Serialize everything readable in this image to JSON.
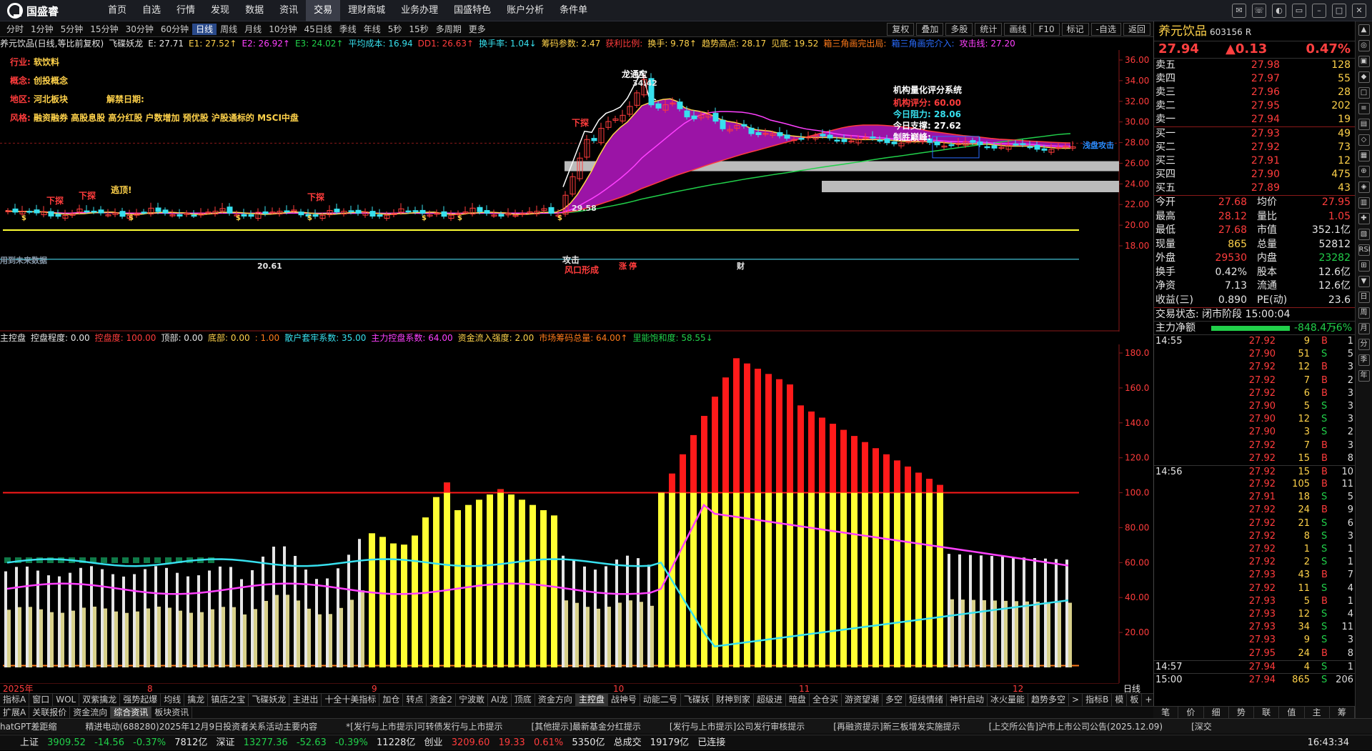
{
  "app": {
    "brand": "国盛睿"
  },
  "menu": [
    "首页",
    "自选",
    "行情",
    "发现",
    "数据",
    "资讯",
    "交易",
    "理财商城",
    "业务办理",
    "国盛特色",
    "账户分析",
    "条件单"
  ],
  "menu_active": "交易",
  "periods": [
    "分时",
    "1分钟",
    "5分钟",
    "15分钟",
    "30分钟",
    "60分钟",
    "日线",
    "周线",
    "月线",
    "10分钟",
    "45日线",
    "季线",
    "年线",
    "5秒",
    "15秒",
    "多周期",
    "更多"
  ],
  "period_active": "日线",
  "tools": [
    "复权",
    "叠加",
    "多股",
    "统计",
    "画线",
    "F10",
    "标记",
    "-自选",
    "返回"
  ],
  "main_indicators": [
    {
      "t": "养元饮品(日线,等比前复权)",
      "c": "#e6e6e6"
    },
    {
      "t": "飞碟妖龙",
      "c": "#e6e6e6"
    },
    {
      "t": "E: 27.71",
      "c": "#e6e6e6"
    },
    {
      "t": "E1: 27.52↑",
      "c": "#ffd24a"
    },
    {
      "t": "E2: 26.92↑",
      "c": "#ff40ff"
    },
    {
      "t": "E3: 24.02↑",
      "c": "#21d04a"
    },
    {
      "t": "平均成本: 16.94",
      "c": "#37e0ee"
    },
    {
      "t": "DD1: 26.63↑",
      "c": "#ff3c3c"
    },
    {
      "t": "换手率: 1.04↓",
      "c": "#37e0ee"
    },
    {
      "t": "筹码参数: 2.47",
      "c": "#ffd24a"
    },
    {
      "t": "获利比例:",
      "c": "#ff3c3c"
    },
    {
      "t": "换手: 9.78↑",
      "c": "#ffd24a"
    },
    {
      "t": "趋势高点: 28.17",
      "c": "#ffd24a"
    },
    {
      "t": "见底: 19.52",
      "c": "#ffd24a"
    },
    {
      "t": "箱三角画完出局:",
      "c": "#ff7a1a"
    },
    {
      "t": "箱三角画完介入:",
      "c": "#2a6cff"
    },
    {
      "t": "攻击线: 27.20",
      "c": "#ff40ff"
    }
  ],
  "info": {
    "industry": {
      "k": "行业:",
      "v": "软饮料"
    },
    "concept": {
      "k": "概念:",
      "v": "创投概念"
    },
    "region": {
      "k": "地区:",
      "v": "河北板块"
    },
    "unlock": {
      "k": "解禁日期:",
      "v": ""
    },
    "style": {
      "k": "风格:",
      "v": "融资融券 高股息股 高分红股 户数增加 预优股 沪股通标的 MSCI中盘"
    }
  },
  "rating": {
    "title": "机构量化评分系统",
    "score": "机构评分:  60.00",
    "resist": "今日阻力:  28.06",
    "support": "今日支撑:  27.62",
    "peak": "制胜巅峰:"
  },
  "chart_labels": {
    "dragon": "龙通宝",
    "top_val": "34.42",
    "price_2958": "29.58",
    "low_val": "20.61",
    "wind": "风口形成",
    "attack": "攻击",
    "dig": "逃顶!",
    "xibo": "下探",
    "future": "用到未来数据",
    "zhang": "涨",
    "ting": "停",
    "cai": "财",
    "s_mark": "$",
    "shallow": "浅盘攻击"
  },
  "main_yaxis": [
    "36.00",
    "34.00",
    "32.00",
    "30.00",
    "28.00",
    "26.00",
    "24.00",
    "22.00",
    "20.00",
    "18.00"
  ],
  "sub_indicators": [
    {
      "t": "主控盘",
      "c": "#e6e6e6"
    },
    {
      "t": "控盘程度: 0.00",
      "c": "#e6e6e6"
    },
    {
      "t": "控盘度: 100.00",
      "c": "#ff3c3c"
    },
    {
      "t": "顶部: 0.00",
      "c": "#e6e6e6"
    },
    {
      "t": "底部: 0.00",
      "c": "#ffd24a"
    },
    {
      "t": ": 1.00",
      "c": "#ff7a1a"
    },
    {
      "t": "散户套牢系数: 35.00",
      "c": "#37e0ee"
    },
    {
      "t": "主力控盘系数: 64.00",
      "c": "#ff40ff"
    },
    {
      "t": "资金流入强度: 2.00",
      "c": "#ffd24a"
    },
    {
      "t": "市场筹码总量: 64.00↑",
      "c": "#ff7a1a"
    },
    {
      "t": "里能饱和度: 58.55↓",
      "c": "#21d04a"
    }
  ],
  "sub_yaxis": [
    "180.0",
    "160.0",
    "140.0",
    "120.0",
    "100.0",
    "80.00",
    "60.00",
    "40.00",
    "20.00"
  ],
  "xaxis": {
    "labels": [
      "2025年",
      "8",
      "9",
      "10",
      "11",
      "12"
    ],
    "right": "日线"
  },
  "bottom_tabs": [
    "指标A",
    "窗口",
    "WOL",
    "双紫擒龙",
    "强势起爆",
    "均线",
    "擒龙",
    "镇店之宝",
    "飞碟妖龙",
    "主进出",
    "十全十美指标",
    "加仓",
    "转点",
    "资金2",
    "宁波敢",
    "AI龙",
    "顶底",
    "资金方向",
    "主控盘",
    "战神号",
    "动能二号",
    "飞碟妖",
    "财神到家",
    "超级进",
    "暗盘",
    "全仓买",
    "游资望潮",
    "多空",
    "短线情绪",
    "神针启动",
    "冰火量能",
    "趋势多空",
    ">",
    "指标B",
    "模",
    "板",
    "+",
    "-"
  ],
  "bottom_active": "主控盘",
  "bottom_tabs2": [
    "扩展A",
    "关联报价",
    "资金流向",
    "综合资讯",
    "板块资讯"
  ],
  "bottom_tabs2_active": "综合资讯",
  "ticker": [
    "hatGPT差距缩",
    "精进电动(688280)2025年12月9日投资者关系活动主要内容",
    "*[发行与上市提示]可转债发行与上市提示",
    "[其他提示]最新基金分红提示",
    "[发行与上市提示]公司发行审核提示",
    "[再融资提示]新三板增发实施提示",
    "[上交所公告]沪市上市公司公告(2025.12.09)",
    "[深交"
  ],
  "status": {
    "sh": {
      "name": "上证",
      "price": "3909.52",
      "chg": "-14.56",
      "pct": "-0.37%",
      "amt": "7812亿"
    },
    "sz": {
      "name": "深证",
      "price": "13277.36",
      "chg": "-52.63",
      "pct": "-0.39%",
      "amt": "11228亿"
    },
    "cy": {
      "name": "创业",
      "price": "3209.60",
      "chg": "19.33",
      "pct": "0.61%",
      "amt": "5350亿"
    },
    "total_label": "总成交",
    "total": "19179亿",
    "conn": "已连接",
    "time": "16:43:34"
  },
  "stock": {
    "name": "养元饮品",
    "code": "603156",
    "flag": "R",
    "price": "27.94",
    "chg": "▲0.13",
    "pct": "0.47%"
  },
  "orderbook": {
    "sell": [
      {
        "l": "卖五",
        "p": "27.98",
        "v": "128"
      },
      {
        "l": "卖四",
        "p": "27.97",
        "v": "55"
      },
      {
        "l": "卖三",
        "p": "27.96",
        "v": "28"
      },
      {
        "l": "卖二",
        "p": "27.95",
        "v": "202"
      },
      {
        "l": "卖一",
        "p": "27.94",
        "v": "19"
      }
    ],
    "buy": [
      {
        "l": "买一",
        "p": "27.93",
        "v": "49"
      },
      {
        "l": "买二",
        "p": "27.92",
        "v": "73"
      },
      {
        "l": "买三",
        "p": "27.91",
        "v": "12"
      },
      {
        "l": "买四",
        "p": "27.90",
        "v": "475"
      },
      {
        "l": "买五",
        "p": "27.89",
        "v": "43"
      }
    ]
  },
  "quote": [
    {
      "a": "今开",
      "b": "27.68",
      "bc": "#ff3c3c",
      "c": "均价",
      "d": "27.95",
      "dc": "#ff3c3c"
    },
    {
      "a": "最高",
      "b": "28.12",
      "bc": "#ff3c3c",
      "c": "量比",
      "d": "1.05",
      "dc": "#ff3c3c"
    },
    {
      "a": "最低",
      "b": "27.68",
      "bc": "#ff3c3c",
      "c": "市值",
      "d": "352.1亿",
      "dc": "#e6e6e6"
    },
    {
      "a": "现量",
      "b": "865",
      "bc": "#ffd24a",
      "c": "总量",
      "d": "52812",
      "dc": "#e6e6e6"
    },
    {
      "a": "外盘",
      "b": "29530",
      "bc": "#ff3c3c",
      "c": "内盘",
      "d": "23282",
      "dc": "#21d04a"
    },
    {
      "a": "换手",
      "b": "0.42%",
      "bc": "#e6e6e6",
      "c": "股本",
      "d": "12.6亿",
      "dc": "#e6e6e6"
    },
    {
      "a": "净资",
      "b": "7.13",
      "bc": "#e6e6e6",
      "c": "流通",
      "d": "12.6亿",
      "dc": "#e6e6e6"
    },
    {
      "a": "收益(三)",
      "b": "0.890",
      "bc": "#e6e6e6",
      "c": "PE(动)",
      "d": "23.6",
      "dc": "#e6e6e6"
    }
  ],
  "trade_state": "交易状态: 闭市阶段 15:00:04",
  "netflow": {
    "label": "主力净额",
    "value": "-848.4万",
    "pct": "-6%"
  },
  "ticks": [
    {
      "t": "14:55",
      "p": "27.92",
      "v": "9",
      "f": "B",
      "n": "1"
    },
    {
      "t": "",
      "p": "27.90",
      "v": "51",
      "f": "S",
      "n": "5"
    },
    {
      "t": "",
      "p": "27.92",
      "v": "12",
      "f": "B",
      "n": "3"
    },
    {
      "t": "",
      "p": "27.92",
      "v": "7",
      "f": "B",
      "n": "2"
    },
    {
      "t": "",
      "p": "27.92",
      "v": "6",
      "f": "B",
      "n": "3"
    },
    {
      "t": "",
      "p": "27.90",
      "v": "5",
      "f": "S",
      "n": "3"
    },
    {
      "t": "",
      "p": "27.90",
      "v": "12",
      "f": "S",
      "n": "3"
    },
    {
      "t": "",
      "p": "27.90",
      "v": "3",
      "f": "S",
      "n": "2"
    },
    {
      "t": "",
      "p": "27.92",
      "v": "7",
      "f": "B",
      "n": "3"
    },
    {
      "t": "",
      "p": "27.92",
      "v": "15",
      "f": "B",
      "n": "8"
    },
    {
      "t": "14:56",
      "p": "27.92",
      "v": "15",
      "f": "B",
      "n": "10"
    },
    {
      "t": "",
      "p": "27.92",
      "v": "105",
      "f": "B",
      "n": "11"
    },
    {
      "t": "",
      "p": "27.91",
      "v": "18",
      "f": "S",
      "n": "5"
    },
    {
      "t": "",
      "p": "27.92",
      "v": "24",
      "f": "B",
      "n": "9"
    },
    {
      "t": "",
      "p": "27.92",
      "v": "21",
      "f": "S",
      "n": "6"
    },
    {
      "t": "",
      "p": "27.92",
      "v": "8",
      "f": "S",
      "n": "3"
    },
    {
      "t": "",
      "p": "27.92",
      "v": "1",
      "f": "S",
      "n": "1"
    },
    {
      "t": "",
      "p": "27.92",
      "v": "2",
      "f": "S",
      "n": "1"
    },
    {
      "t": "",
      "p": "27.93",
      "v": "43",
      "f": "B",
      "n": "7"
    },
    {
      "t": "",
      "p": "27.92",
      "v": "11",
      "f": "S",
      "n": "4"
    },
    {
      "t": "",
      "p": "27.93",
      "v": "5",
      "f": "B",
      "n": "1"
    },
    {
      "t": "",
      "p": "27.93",
      "v": "12",
      "f": "S",
      "n": "4"
    },
    {
      "t": "",
      "p": "27.93",
      "v": "34",
      "f": "S",
      "n": "11"
    },
    {
      "t": "",
      "p": "27.93",
      "v": "9",
      "f": "S",
      "n": "3"
    },
    {
      "t": "",
      "p": "27.95",
      "v": "24",
      "f": "B",
      "n": "8"
    },
    {
      "t": "14:57",
      "p": "27.94",
      "v": "4",
      "f": "S",
      "n": "1"
    },
    {
      "t": "15:00",
      "p": "27.94",
      "v": "865",
      "f": "S",
      "n": "206"
    }
  ],
  "right_bottom": [
    "笔",
    "价",
    "细",
    "势",
    "联",
    "值",
    "主",
    "筹"
  ],
  "vtabs": [
    "▲",
    "◎",
    "▣",
    "◆",
    "□",
    "≡",
    "▤",
    "◇",
    "▦",
    "⊕",
    "◈",
    "▥",
    "✚",
    "▧",
    "RSI",
    "⊞",
    "▼",
    "日",
    "周",
    "月",
    "分",
    "季",
    "年"
  ],
  "colors": {
    "up": "#ff3c3c",
    "down": "#21d04a",
    "cyan": "#37e0ee",
    "magenta": "#ff40ff",
    "yellow": "#ffd24a",
    "orange": "#ff7a1a",
    "purple_fill": "#9b14a6",
    "bar_red": "#ff1a1a",
    "bar_yellow": "#ffff33",
    "bar_white": "#e6e6e6"
  }
}
